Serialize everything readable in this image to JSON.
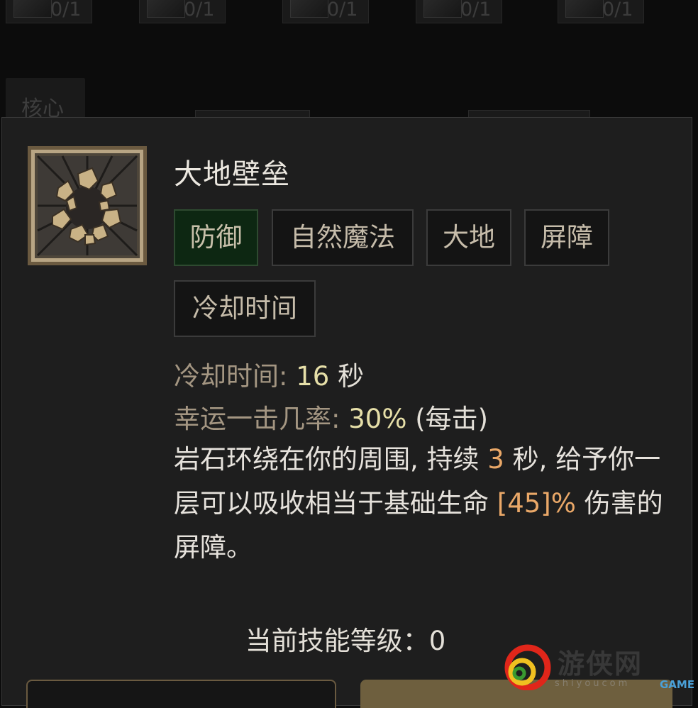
{
  "background": {
    "slot_counts": [
      "0/1",
      "0/1",
      "0/1",
      "0/1",
      "0/1"
    ],
    "core_tab_label": "核心"
  },
  "skill": {
    "name": "大地壁垒",
    "tags": [
      "防御",
      "自然魔法",
      "大地",
      "屏障",
      "冷却时间"
    ],
    "active_tag": "防御",
    "cooldown_label": "冷却时间:",
    "cooldown_value": "16",
    "cooldown_unit": "秒",
    "lucky_hit_label": "幸运一击几率:",
    "lucky_hit_value": "30%",
    "lucky_hit_suffix": "(每击)",
    "description": {
      "part1": "岩石环绕在你的周围, 持续 ",
      "duration": "3",
      "part2": " 秒, 给予你一层可以吸收相当于基础生命 ",
      "percent": "[45]%",
      "part3": " 伤害的屏障。"
    },
    "level_label": "当前技能等级：",
    "level_value": "0"
  },
  "watermark": {
    "text": "游侠网",
    "small_text": "shiyoucom",
    "game_text": "GAME"
  },
  "colors": {
    "panel_bg": "#1e1e1e",
    "active_tag_bg": "#0d2712",
    "label": "#a49682",
    "value": "#e6dfa8",
    "highlight": "#eaa868"
  }
}
